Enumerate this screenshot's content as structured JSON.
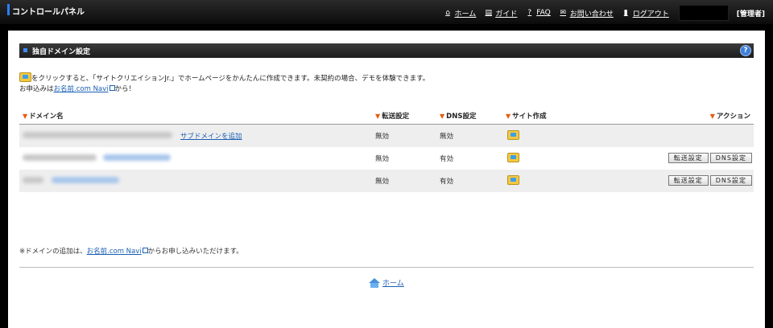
{
  "app": {
    "title": "コントロールパネル"
  },
  "nav": {
    "items": [
      {
        "label": "ホーム",
        "icon": "home-icon",
        "glyph": "⌂"
      },
      {
        "label": "ガイド",
        "icon": "book-icon",
        "glyph": "▤"
      },
      {
        "label": "FAQ",
        "icon": "question-icon",
        "glyph": "?"
      },
      {
        "label": "お問い合わせ",
        "icon": "mail-icon",
        "glyph": "✉"
      },
      {
        "label": "ログアウト",
        "icon": "logout-icon",
        "glyph": "▮"
      }
    ],
    "role": "[管理者]"
  },
  "section": {
    "title": "独自ドメイン設定",
    "help": "?"
  },
  "intro": {
    "line1": "をクリックすると、「サイトクリエイションJr.」でホームページをかんたんに作成できます。未契約の場合、デモを体験できます。",
    "line2_prefix": "お申込みは",
    "line2_link": "お名前.com Navi",
    "line2_suffix": "から！"
  },
  "table": {
    "headers": {
      "domain": "ドメイン名",
      "transfer": "転送設定",
      "dns": "DNS設定",
      "site": "サイト作成",
      "action": "アクション"
    },
    "rows": [
      {
        "subdomain_link": "サブドメインを追加",
        "transfer": "無効",
        "dns": "無効",
        "has_buttons": false
      },
      {
        "subdomain_link": "",
        "transfer": "無効",
        "dns": "有効",
        "has_buttons": true
      },
      {
        "subdomain_link": "",
        "transfer": "無効",
        "dns": "有効",
        "has_buttons": true
      }
    ],
    "buttons": {
      "transfer": "転送設定",
      "dns": "DNS設定"
    }
  },
  "footnote": {
    "prefix": "※ドメインの追加は、",
    "link": "お名前.com Navi",
    "suffix": "からお申し込みいただけます。"
  },
  "footer": {
    "home_label": "ホーム"
  },
  "colors": {
    "accent": "#2a7fff",
    "marker": "#e85c0d",
    "link": "#1a5fb4"
  }
}
